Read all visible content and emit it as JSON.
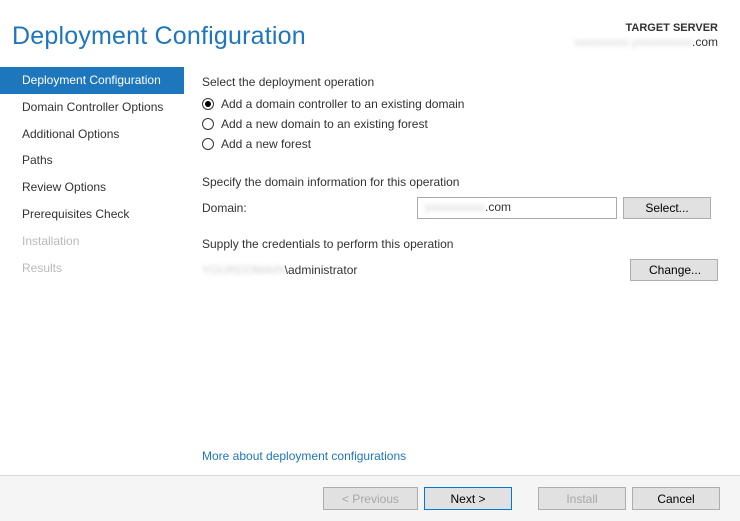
{
  "header": {
    "title": "Deployment Configuration",
    "server_label": "TARGET SERVER",
    "server_name_suffix": ".com"
  },
  "sidebar": {
    "items": [
      {
        "label": "Deployment Configuration",
        "state": "active"
      },
      {
        "label": "Domain Controller Options",
        "state": "normal"
      },
      {
        "label": "Additional Options",
        "state": "normal"
      },
      {
        "label": "Paths",
        "state": "normal"
      },
      {
        "label": "Review Options",
        "state": "normal"
      },
      {
        "label": "Prerequisites Check",
        "state": "normal"
      },
      {
        "label": "Installation",
        "state": "disabled"
      },
      {
        "label": "Results",
        "state": "disabled"
      }
    ]
  },
  "content": {
    "select_operation_label": "Select the deployment operation",
    "radios": [
      {
        "label": "Add a domain controller to an existing domain",
        "selected": true
      },
      {
        "label": "Add a new domain to an existing forest",
        "selected": false
      },
      {
        "label": "Add a new forest",
        "selected": false
      }
    ],
    "specify_domain_label": "Specify the domain information for this operation",
    "domain_label": "Domain:",
    "domain_value_suffix": ".com",
    "select_button": "Select...",
    "credentials_label": "Supply the credentials to perform this operation",
    "credentials_value_suffix": "\\administrator",
    "change_button": "Change...",
    "more_link": "More about deployment configurations"
  },
  "footer": {
    "previous": "< Previous",
    "next": "Next >",
    "install": "Install",
    "cancel": "Cancel"
  }
}
